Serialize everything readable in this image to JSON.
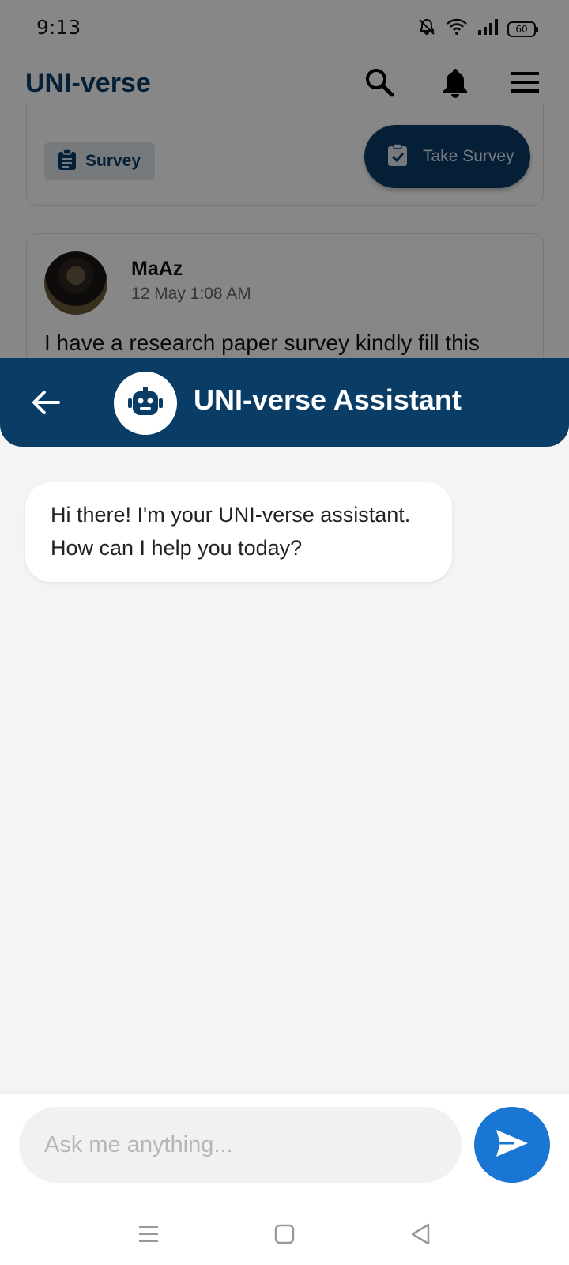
{
  "status_bar": {
    "time": "9:13",
    "battery": "60"
  },
  "app_bar": {
    "title": "UNI-verse"
  },
  "survey_card": {
    "chip_label": "Survey",
    "take_survey_label": "Take Survey"
  },
  "post": {
    "author": "MaAz",
    "timestamp": "12 May 1:08 AM",
    "text": "I have a research paper survey kindly fill this"
  },
  "chat": {
    "title": "UNI-verse Assistant",
    "messages": [
      {
        "from": "assistant",
        "text": "Hi there! I'm your UNI-verse assistant. How can I help you today?"
      }
    ],
    "input_placeholder": "Ask me anything..."
  },
  "colors": {
    "primary": "#0a3d66",
    "send_button": "#1976d2",
    "background": "#f4f4f4"
  },
  "icons": [
    "mute-icon",
    "wifi-icon",
    "signal-icon",
    "battery-icon",
    "search-icon",
    "bell-icon",
    "menu-icon",
    "clipboard-icon",
    "clipboard-check-icon",
    "back-arrow-icon",
    "robot-icon",
    "send-icon",
    "nav-menu-icon",
    "nav-home-icon",
    "nav-back-icon"
  ]
}
